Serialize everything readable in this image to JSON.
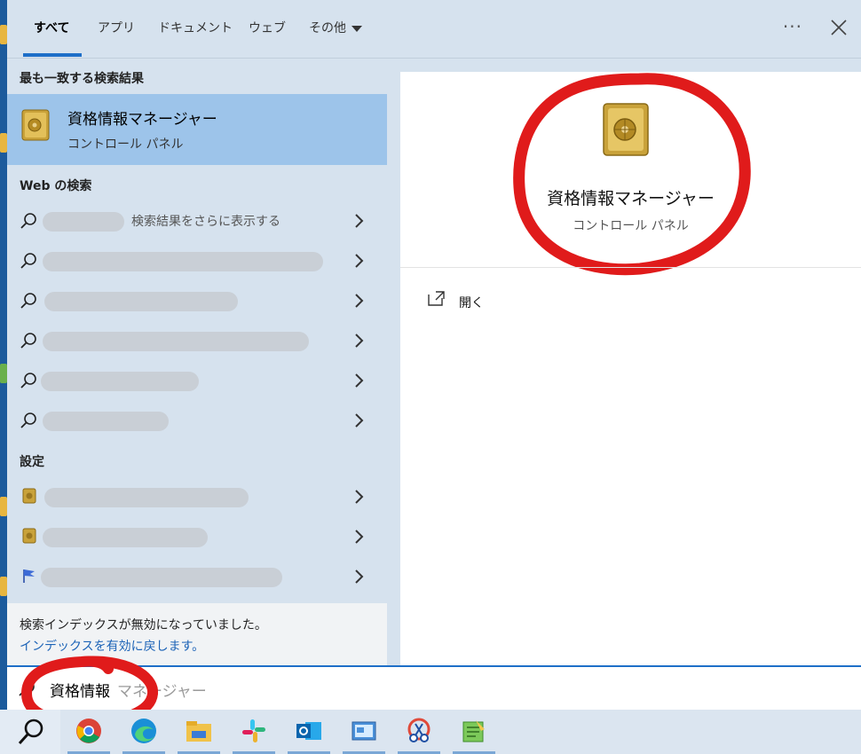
{
  "tabs": {
    "all": "すべて",
    "apps": "アプリ",
    "documents": "ドキュメント",
    "web": "ウェブ",
    "more": "その他",
    "more_icon": "ellipsis-icon",
    "close_icon": "close-icon"
  },
  "best_match": {
    "heading": "最も一致する検索結果",
    "title": "資格情報マネージャー",
    "subtitle": "コントロール パネル"
  },
  "web_search": {
    "heading": "Web の検索",
    "first_extra": "検索結果をさらに表示する"
  },
  "settings": {
    "heading": "設定"
  },
  "notice": {
    "line1": "検索インデックスが無効になっていました。",
    "link": "インデックスを有効に戻します。"
  },
  "detail": {
    "title": "資格情報マネージャー",
    "subtitle": "コントロール パネル",
    "open_label": "開く"
  },
  "search": {
    "typed": "資格情報",
    "hint": "マネージャー"
  },
  "colors": {
    "accent": "#1e6fc8",
    "selected": "#9dc4ea",
    "annotation": "#e01b1b"
  },
  "taskbar": [
    "search-icon",
    "chrome-icon",
    "edge-icon",
    "file-explorer-icon",
    "slack-icon",
    "outlook-icon",
    "control-panel-icon",
    "snipping-tool-icon",
    "notepad-icon"
  ]
}
